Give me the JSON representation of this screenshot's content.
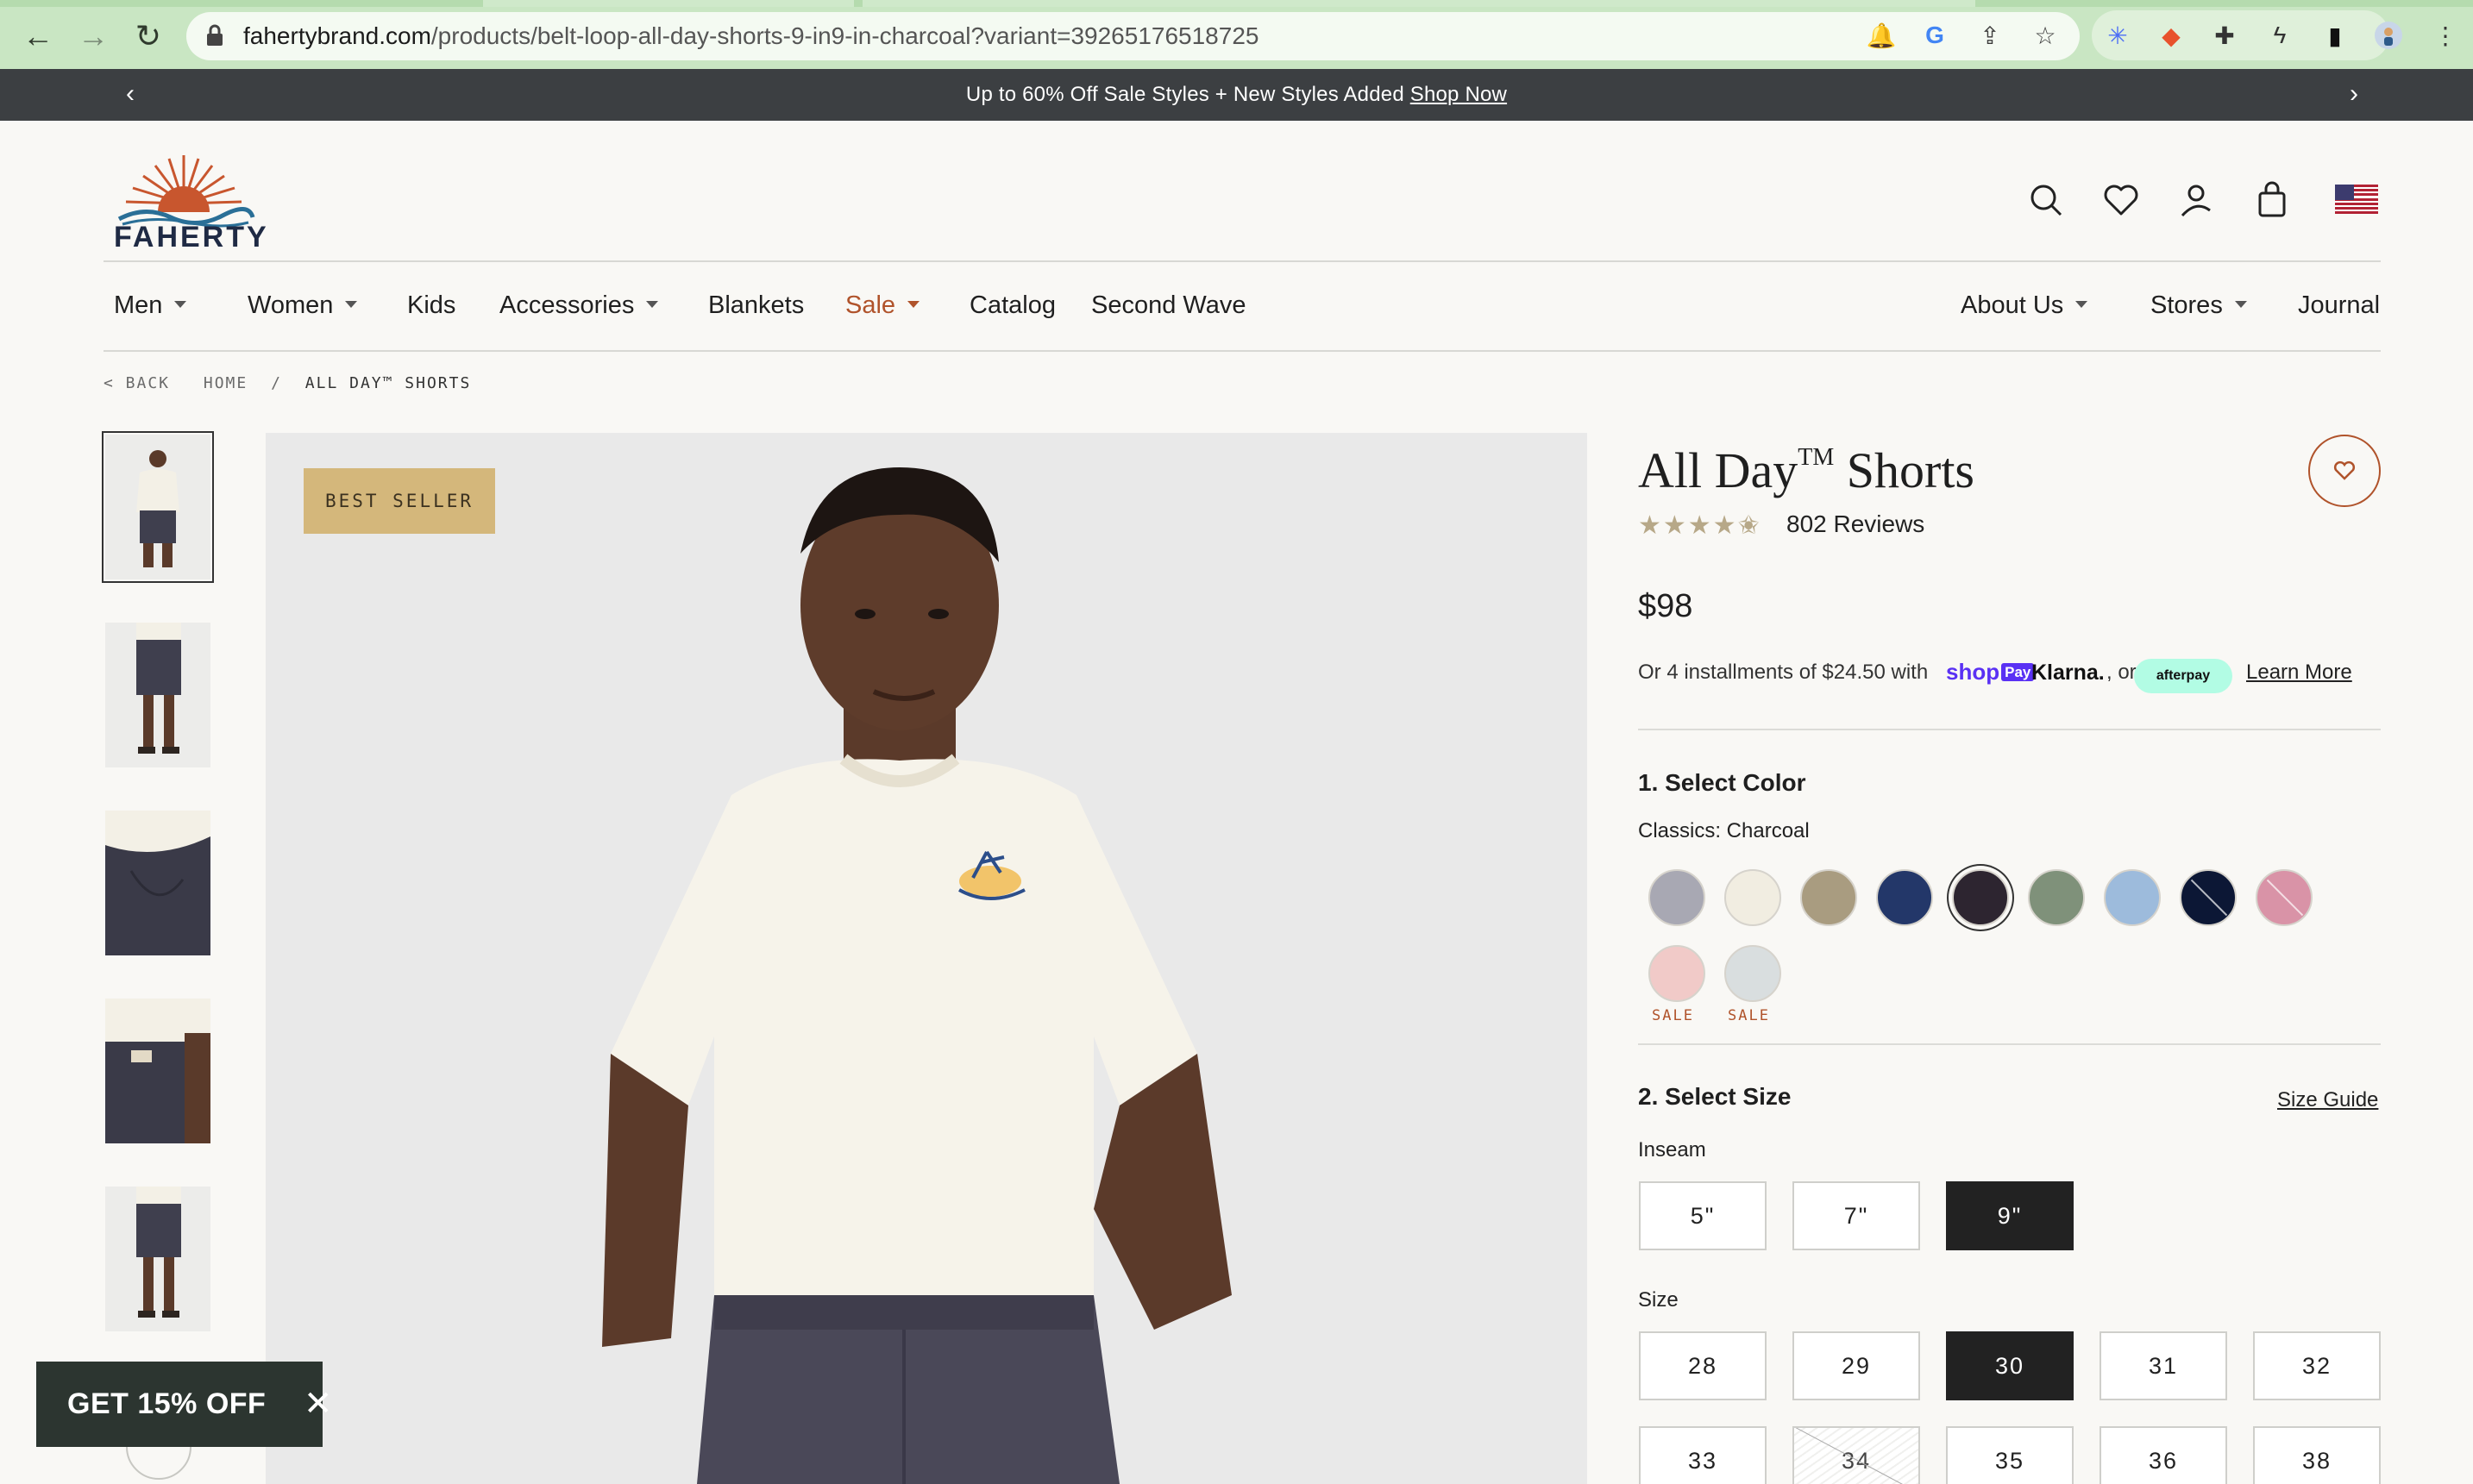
{
  "browser": {
    "url_host": "fahertybrand.com",
    "url_path": "/products/belt-loop-all-day-shorts-9-in9-in-charcoal?variant=39265176518725"
  },
  "promo": {
    "message": "Up to 60% Off Sale Styles + New Styles Added ",
    "link": "Shop Now"
  },
  "brand": {
    "name": "FAHERTY"
  },
  "nav": {
    "items": [
      {
        "label": "Men"
      },
      {
        "label": "Women"
      },
      {
        "label": "Kids"
      },
      {
        "label": "Accessories"
      },
      {
        "label": "Blankets"
      },
      {
        "label": "Sale"
      },
      {
        "label": "Catalog"
      },
      {
        "label": "Second Wave"
      },
      {
        "label": "About Us"
      },
      {
        "label": "Stores"
      },
      {
        "label": "Journal"
      }
    ]
  },
  "breadcrumb": {
    "back": "< BACK",
    "home": "HOME",
    "sep": "/",
    "current": "ALL DAY™ SHORTS"
  },
  "product": {
    "badge": "BEST SELLER",
    "title": "All Day",
    "tm": "TM",
    "title_suffix": " Shorts",
    "rating": 4.5,
    "stars": "★★★★✬",
    "reviews": "802 Reviews",
    "price": "$98",
    "installments": "Or 4 installments of $24.50 with",
    "shoppay": "shop",
    "shoppay_pay": "Pay",
    "klarna": "Klarna.",
    "or": ", or",
    "afterpay": "afterpay",
    "learn_more": "Learn More"
  },
  "color": {
    "heading": "1. Select Color",
    "selected_label": "Classics: Charcoal",
    "swatches": [
      {
        "color": "#a8a8b3"
      },
      {
        "color": "#f1ede1"
      },
      {
        "color": "#a99c80"
      },
      {
        "color": "#233769"
      },
      {
        "color": "#2d2530"
      },
      {
        "color": "#7f917a"
      },
      {
        "color": "#9dbbdc"
      },
      {
        "color": "#0c1735"
      },
      {
        "color": "#d993a7"
      },
      {
        "color": "#f1cac8",
        "sale": "SALE"
      },
      {
        "color": "#d9dedf",
        "sale": "SALE"
      }
    ]
  },
  "size": {
    "heading": "2. Select Size",
    "guide": "Size Guide",
    "inseam_label": "Inseam",
    "inseams": [
      "5\"",
      "7\"",
      "9\""
    ],
    "size_label": "Size",
    "sizes": [
      "28",
      "29",
      "30",
      "31",
      "32",
      "33",
      "34",
      "35",
      "36",
      "38"
    ]
  },
  "popup": {
    "text": "GET 15% OFF"
  },
  "colors": {
    "accent": "#b0532b",
    "badge": "#d4b77b",
    "promo_bg": "#3c3f42",
    "chrome": "#c9e6c3"
  }
}
